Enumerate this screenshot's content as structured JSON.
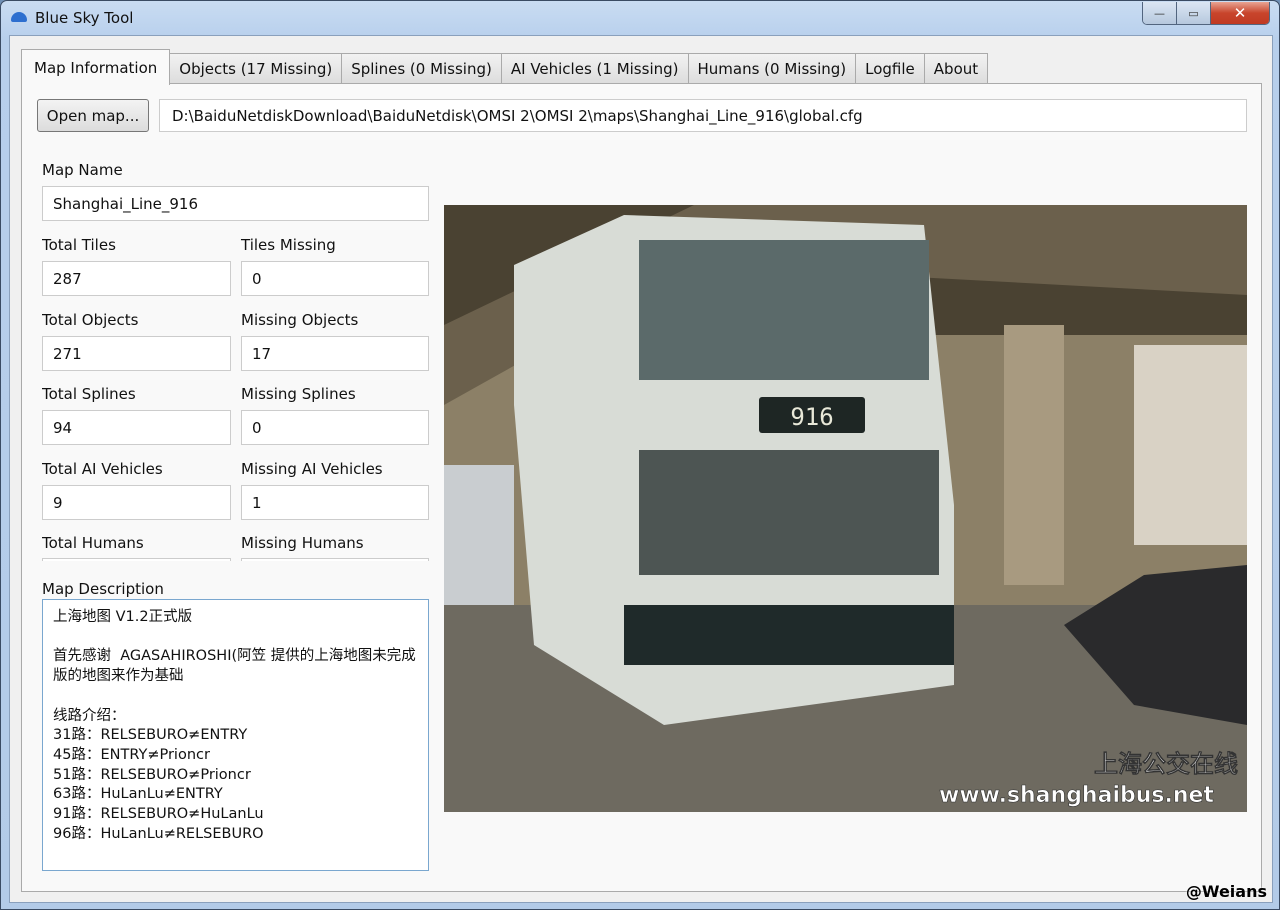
{
  "window": {
    "title": "Blue Sky Tool",
    "minimize": "—",
    "maximize": "▭",
    "close": "✕"
  },
  "tabs": [
    "Map Information",
    "Objects (17 Missing)",
    "Splines (0 Missing)",
    "AI Vehicles (1 Missing)",
    "Humans (0 Missing)",
    "Logfile",
    "About"
  ],
  "open_map": {
    "label": "Open map...",
    "path": "D:\\BaiduNetdiskDownload\\BaiduNetdisk\\OMSI 2\\OMSI 2\\maps\\Shanghai_Line_916\\global.cfg"
  },
  "fields": {
    "map_name": {
      "label": "Map Name",
      "value": "Shanghai_Line_916"
    },
    "total_tiles": {
      "label": "Total Tiles",
      "value": "287"
    },
    "tiles_missing": {
      "label": "Tiles Missing",
      "value": "0"
    },
    "total_objects": {
      "label": "Total Objects",
      "value": "271"
    },
    "missing_objects": {
      "label": "Missing Objects",
      "value": "17"
    },
    "total_splines": {
      "label": "Total Splines",
      "value": "94"
    },
    "missing_splines": {
      "label": "Missing Splines",
      "value": "0"
    },
    "total_ai": {
      "label": "Total AI Vehicles",
      "value": "9"
    },
    "missing_ai": {
      "label": "Missing AI Vehicles",
      "value": "1"
    },
    "total_humans": {
      "label": "Total Humans",
      "value": ""
    },
    "missing_humans": {
      "label": "Missing Humans",
      "value": ""
    }
  },
  "description": {
    "label": "Map Description",
    "text": "上海地图 V1.2正式版\n\n首先感谢  AGASAHIROSHI(阿笠 提供的上海地图未完成版的地图来作为基础\n\n线路介绍：\n31路：RELSEBURO≠ENTRY\n45路：ENTRY≠Prioncr\n51路：RELSEBURO≠Prioncr\n63路：HuLanLu≠ENTRY\n91路：RELSEBURO≠HuLanLu\n96路：HuLanLu≠RELSEBURO"
  },
  "photo": {
    "route_sign": "916",
    "caption_cn": "上海公交在线",
    "caption_url": "www.shanghaibus.net"
  },
  "watermark": "@Weians"
}
